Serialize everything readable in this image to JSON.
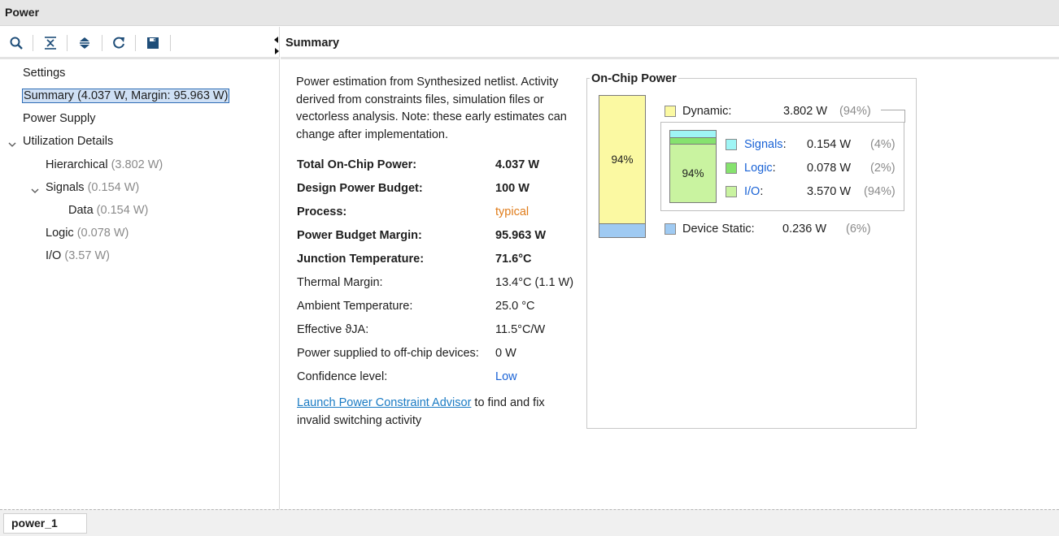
{
  "window": {
    "title": "Power"
  },
  "toolbar": {
    "icons": [
      "search-icon",
      "collapse-all-icon",
      "expand-all-icon",
      "refresh-icon",
      "save-icon"
    ]
  },
  "tree": {
    "settings": "Settings",
    "summary": "Summary (4.037 W, Margin: 95.963 W)",
    "power_supply": "Power Supply",
    "utilization": "Utilization Details",
    "hierarchical": {
      "label": "Hierarchical",
      "value": "(3.802 W)"
    },
    "signals": {
      "label": "Signals",
      "value": "(0.154 W)"
    },
    "data": {
      "label": "Data",
      "value": "(0.154 W)"
    },
    "logic": {
      "label": "Logic",
      "value": "(0.078 W)"
    },
    "io": {
      "label": "I/O",
      "value": "(3.57 W)"
    }
  },
  "summary": {
    "header": "Summary",
    "description": "Power estimation from Synthesized netlist. Activity derived from constraints files, simulation files or vectorless analysis. Note: these early estimates can change after implementation.",
    "rows": [
      {
        "key": "Total On-Chip Power:",
        "value": "4.037 W"
      },
      {
        "key": "Design Power Budget:",
        "value": "100 W"
      },
      {
        "key": "Process:",
        "value": "typical"
      },
      {
        "key": "Power Budget Margin:",
        "value": "95.963 W"
      },
      {
        "key": "Junction Temperature:",
        "value": "71.6°C"
      },
      {
        "key": "Thermal Margin:",
        "value": "13.4°C (1.1 W)"
      },
      {
        "key": "Ambient Temperature:",
        "value": "25.0 °C"
      },
      {
        "key": "Effective ϑJA:",
        "value": "11.5°C/W"
      },
      {
        "key": "Power supplied to off-chip devices:",
        "value": "0 W"
      },
      {
        "key": "Confidence level:",
        "value": "Low"
      }
    ],
    "advisor_link": "Launch Power Constraint Advisor",
    "advisor_text": " to find and fix invalid switching activity"
  },
  "onchip": {
    "title": "On-Chip Power",
    "dynamic_share": 0.94,
    "static_share": 0.06,
    "bar_pct_label": "94%",
    "dynamic": {
      "label": "Dynamic:",
      "value": "3.802 W",
      "pct": "(94%)",
      "color": "#fbf9a2"
    },
    "signals": {
      "label": "Signals",
      "colon": ":",
      "value": "0.154 W",
      "pct": "(4%)",
      "color": "#9ff5f5"
    },
    "logic": {
      "label": "Logic",
      "colon": ":",
      "value": "0.078 W",
      "pct": "(2%)",
      "color": "#86e26e"
    },
    "io": {
      "label": "I/O",
      "colon": ":",
      "value": "3.570 W",
      "pct": "(94%)",
      "color": "#c9f3a0"
    },
    "static": {
      "label": "Device Static:",
      "value": "0.236 W",
      "pct": "(6%)",
      "color": "#9fcaf2"
    },
    "inner_pct_label": "94%"
  },
  "bottom": {
    "tab": "power_1"
  }
}
